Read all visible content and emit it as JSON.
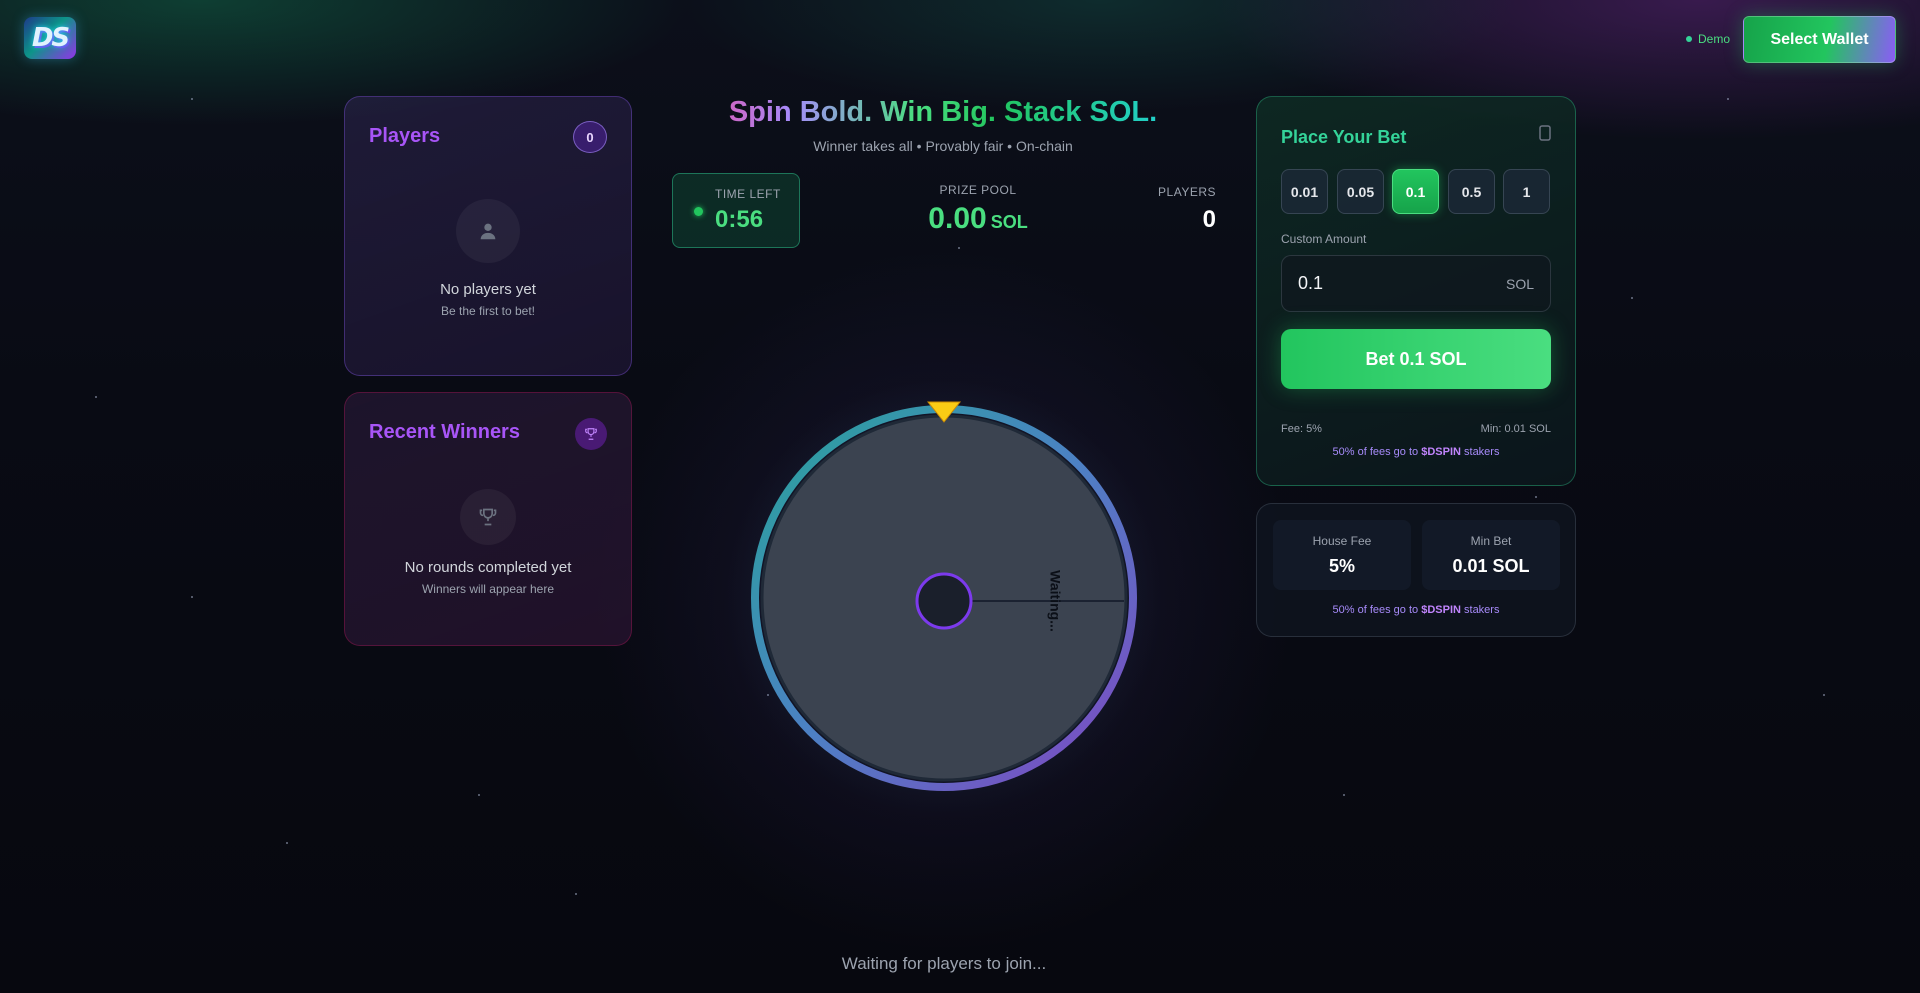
{
  "header": {
    "logo_text": "DS",
    "mode_label": "Demo",
    "wallet_button": "Select Wallet"
  },
  "players_panel": {
    "title": "Players",
    "count": "0",
    "empty_icon": "user-icon",
    "empty_title": "No players yet",
    "empty_subtitle": "Be the first to bet!"
  },
  "winners_panel": {
    "title": "Recent Winners",
    "badge_icon": "trophy-icon",
    "empty_icon": "trophy-icon",
    "empty_title": "No rounds completed yet",
    "empty_subtitle": "Winners will appear here"
  },
  "hero": {
    "headline": "Spin Bold. Win Big. Stack SOL.",
    "subline": "Winner takes all • Provably fair • On-chain"
  },
  "round": {
    "time_left_label": "TIME LEFT",
    "time_left": "0:56",
    "prize_pool_label": "PRIZE POOL",
    "prize_pool": "0.00",
    "prize_unit": "SOL",
    "players_label": "PLAYERS",
    "players_count": "0"
  },
  "wheel": {
    "waiting_label": "Waiting...",
    "status": "Waiting for players to join..."
  },
  "bet": {
    "title": "Place Your Bet",
    "info_icon": "info-icon",
    "chips": [
      "0.01",
      "0.05",
      "0.1",
      "0.5",
      "1"
    ],
    "active_chip": "0.1",
    "custom_label": "Custom Amount",
    "amount_value": "0.1",
    "amount_unit": "SOL",
    "bet_button": "Bet 0.1 SOL",
    "fee_text": "Fee: 5%",
    "min_text": "Min: 0.01 SOL",
    "stakers_prefix": "50% of fees go to ",
    "stakers_token": "$DSPIN",
    "stakers_suffix": " stakers"
  },
  "stats": {
    "house_fee_label": "House Fee",
    "house_fee": "5%",
    "min_bet_label": "Min Bet",
    "min_bet": "0.01 SOL",
    "stakers_prefix": "50% of fees go to ",
    "stakers_token": "$DSPIN",
    "stakers_suffix": " stakers"
  },
  "colors": {
    "accent_green": "#22c55e",
    "accent_purple": "#a855f7",
    "background": "#090b14"
  }
}
